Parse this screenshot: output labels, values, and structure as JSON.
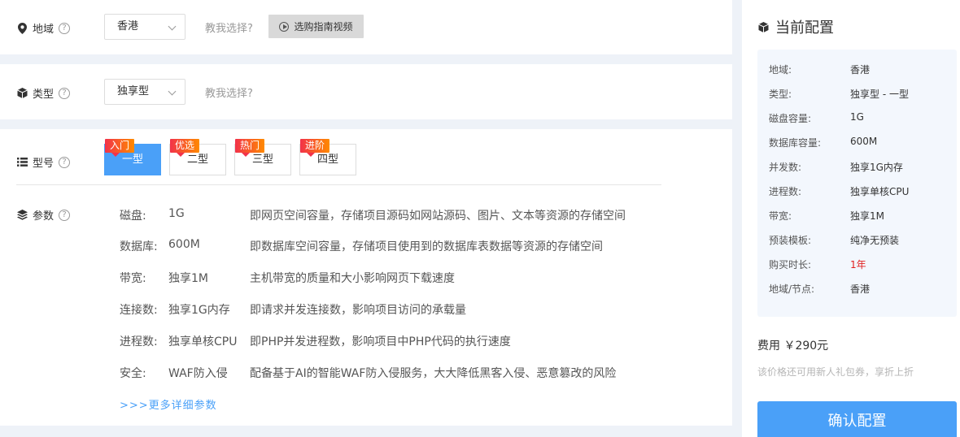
{
  "region": {
    "label": "地域",
    "help": "?",
    "select_value": "香港",
    "hint": "教我选择?",
    "video_button": "选购指南视频"
  },
  "type": {
    "label": "类型",
    "help": "?",
    "select_value": "独享型",
    "hint": "教我选择?"
  },
  "model": {
    "label": "型号",
    "help": "?",
    "options": [
      {
        "label": "一型",
        "tag": "入门"
      },
      {
        "label": "二型",
        "tag": "优选"
      },
      {
        "label": "三型",
        "tag": "热门"
      },
      {
        "label": "四型",
        "tag": "进阶"
      }
    ]
  },
  "params": {
    "label": "参数",
    "help": "?",
    "rows": [
      {
        "name": "磁盘:",
        "value": "1G",
        "desc": "即网页空间容量，存储项目源码如网站源码、图片、文本等资源的存储空间"
      },
      {
        "name": "数据库:",
        "value": "600M",
        "desc": "即数据库空间容量，存储项目使用到的数据库表数据等资源的存储空间"
      },
      {
        "name": "带宽:",
        "value": "独享1M",
        "desc": "主机带宽的质量和大小影响网页下载速度"
      },
      {
        "name": "连接数:",
        "value": "独享1G内存",
        "desc": "即请求并发连接数，影响项目访问的承载量"
      },
      {
        "name": "进程数:",
        "value": "独享单核CPU",
        "desc": "即PHP并发进程数，影响项目中PHP代码的执行速度"
      },
      {
        "name": "安全:",
        "value": "WAF防入侵",
        "desc": "配备基于AI的智能WAF防入侵服务，大大降低黑客入侵、恶意篡改的风险"
      }
    ],
    "more_link": ">>>更多详细参数"
  },
  "config": {
    "title": "当前配置",
    "rows": [
      {
        "k": "地域:",
        "v": "香港"
      },
      {
        "k": "类型:",
        "v": "独享型 - 一型"
      },
      {
        "k": "磁盘容量:",
        "v": "1G"
      },
      {
        "k": "数据库容量:",
        "v": "600M"
      },
      {
        "k": "并发数:",
        "v": "独享1G内存"
      },
      {
        "k": "进程数:",
        "v": "独享单核CPU"
      },
      {
        "k": "带宽:",
        "v": "独享1M"
      },
      {
        "k": "预装模板:",
        "v": "纯净无预装"
      },
      {
        "k": "购买时长:",
        "v": "1年"
      },
      {
        "k": "地域/节点:",
        "v": "香港"
      }
    ],
    "fee": "费用 ￥290元",
    "fee_note": "该价格还可用新人礼包券，享折上折",
    "confirm_button": "确认配置"
  },
  "colors": {
    "accent": "#4aa0f8",
    "tag_gradient_start": "#f2324a",
    "tag_gradient_end": "#ff8a00",
    "price_red": "#e02020"
  },
  "icons": {
    "region": "map-pin-icon",
    "type": "cube-icon",
    "model": "list-icon",
    "params": "layers-icon",
    "config": "cube-icon",
    "video": "play-circle-icon"
  }
}
